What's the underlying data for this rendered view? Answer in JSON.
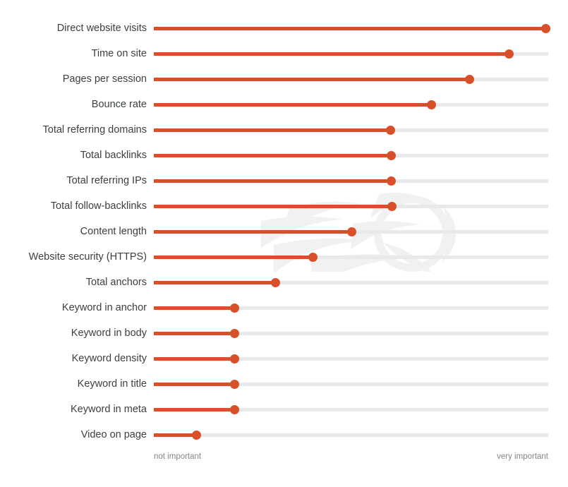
{
  "chart_data": {
    "type": "bar",
    "title": "",
    "subtitle": "",
    "xlabel": "",
    "ylabel": "",
    "grid": false,
    "legend": "none",
    "orientation": "horizontal",
    "style": "lollipop",
    "axis_min_label": "not important",
    "axis_max_label": "very important",
    "xlim": [
      0,
      100
    ],
    "accent_color": "#d8502a",
    "track_color": "#e9e9eb",
    "label_color": "#3c4043",
    "caption_color": "#80868b",
    "categories": [
      "Direct website visits",
      "Time on site",
      "Pages per session",
      "Bounce rate",
      "Total referring domains",
      "Total backlinks",
      "Total referring IPs",
      "Total follow-backlinks",
      "Content length",
      "Website security (HTTPS)",
      "Total anchors",
      "Keyword in anchor",
      "Keyword in body",
      "Keyword density",
      "Keyword in title",
      "Keyword in meta",
      "Video on page"
    ],
    "values": [
      99.3,
      90.0,
      80.0,
      70.0,
      60.0,
      60.2,
      60.2,
      60.4,
      50.1,
      40.2,
      30.8,
      20.4,
      20.4,
      20.4,
      20.4,
      20.4,
      10.7
    ]
  },
  "watermark": {
    "name": "flaming-wheel-logo",
    "color": "#f1f1f1"
  }
}
